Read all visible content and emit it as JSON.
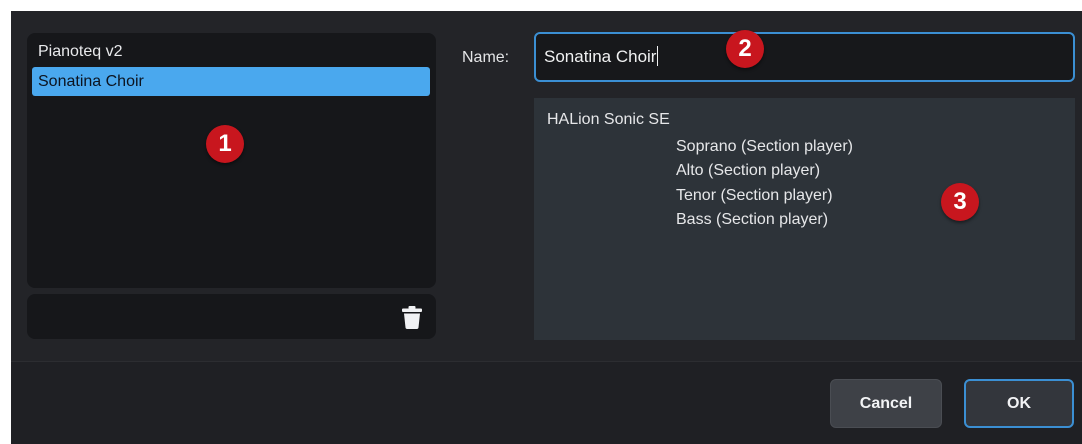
{
  "instrument_list": {
    "items": [
      {
        "label": "Pianoteq v2",
        "selected": false
      },
      {
        "label": "Sonatina Choir",
        "selected": true
      }
    ]
  },
  "toolbar": {
    "delete_icon": "trash-icon"
  },
  "name_field": {
    "label": "Name:",
    "value": "Sonatina Choir"
  },
  "info": {
    "title": "HALion Sonic SE",
    "lines": [
      "Soprano (Section player)",
      "Alto (Section player)",
      "Tenor (Section player)",
      "Bass (Section player)"
    ]
  },
  "callouts": [
    "1",
    "2",
    "3"
  ],
  "buttons": {
    "cancel": "Cancel",
    "ok": "OK"
  },
  "colors": {
    "accent": "#3b8fd3",
    "selection": "#4aa8ee",
    "callout": "#c8161e"
  }
}
